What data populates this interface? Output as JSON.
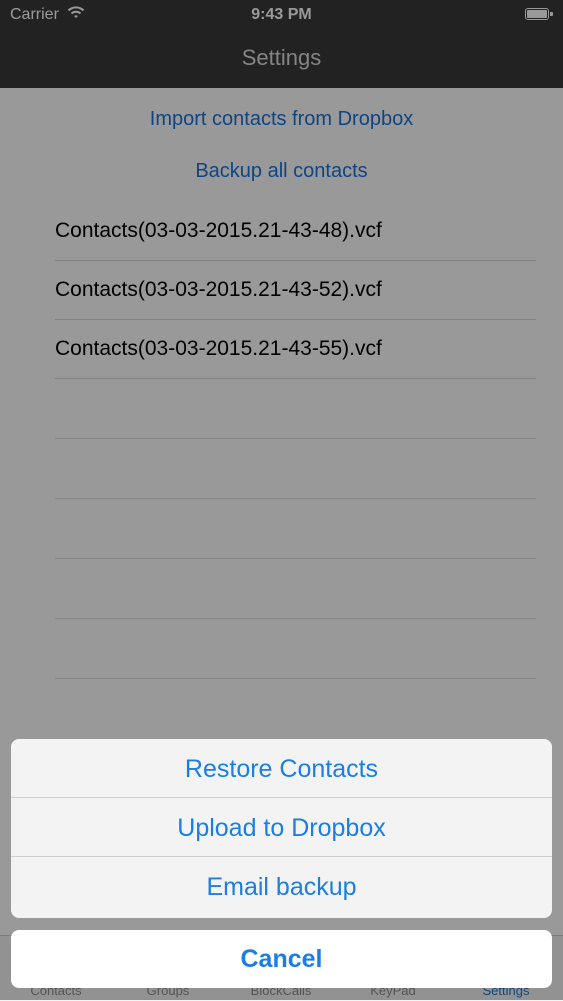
{
  "status_bar": {
    "carrier": "Carrier",
    "time": "9:43 PM",
    "wifi_icon": "wifi-icon",
    "battery_icon": "battery-icon"
  },
  "nav": {
    "title": "Settings"
  },
  "settings": {
    "import_label": "Import contacts from Dropbox",
    "backup_label": "Backup all contacts",
    "files": [
      "Contacts(03-03-2015.21-43-48).vcf",
      "Contacts(03-03-2015.21-43-52).vcf",
      "Contacts(03-03-2015.21-43-55).vcf"
    ]
  },
  "tab_bar": {
    "items": [
      "Contacts",
      "Groups",
      "BlockCalls",
      "KeyPad",
      "Settings"
    ],
    "active": "Settings"
  },
  "action_sheet": {
    "actions": [
      "Restore Contacts",
      "Upload to Dropbox",
      "Email backup"
    ],
    "cancel_label": "Cancel"
  },
  "colors": {
    "accent": "#1a7ee3",
    "nav_background": "#3a3a3a"
  }
}
